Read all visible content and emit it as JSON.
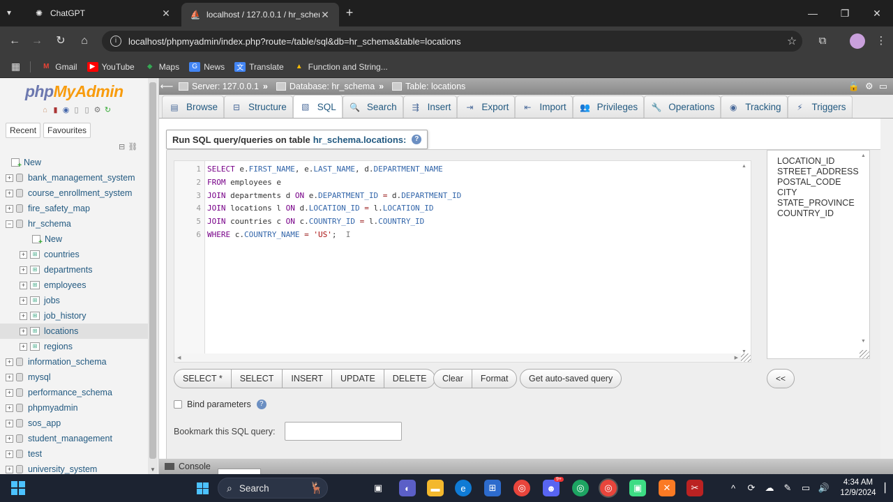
{
  "browser": {
    "tabs": [
      {
        "title": "ChatGPT",
        "icon": "openai-icon",
        "active": false
      },
      {
        "title": "localhost / 127.0.0.1 / hr_schem",
        "icon": "phpmyadmin-sail-icon",
        "active": true
      }
    ],
    "url": "localhost/phpmyadmin/index.php?route=/table/sql&db=hr_schema&table=locations",
    "bookmarks": [
      {
        "label": "Gmail",
        "color": "#ea4335"
      },
      {
        "label": "YouTube",
        "color": "#ff0000"
      },
      {
        "label": "Maps",
        "color": "#34a853"
      },
      {
        "label": "News",
        "color": "#4285f4"
      },
      {
        "label": "Translate",
        "color": "#4285f4"
      },
      {
        "label": "Function and String...",
        "color": "#fbbc04"
      }
    ]
  },
  "sidebar": {
    "logo_php": "php",
    "logo_myadmin": "MyAdmin",
    "tabs": [
      "Recent",
      "Favourites"
    ],
    "new_label": "New",
    "databases": [
      {
        "name": "bank_management_system"
      },
      {
        "name": "course_enrollment_system"
      },
      {
        "name": "fire_safety_map"
      },
      {
        "name": "hr_schema",
        "expanded": true
      }
    ],
    "hr_children": [
      "New",
      "countries",
      "departments",
      "employees",
      "jobs",
      "job_history",
      "locations",
      "regions"
    ],
    "databases_after": [
      "information_schema",
      "mysql",
      "performance_schema",
      "phpmyadmin",
      "sos_app",
      "student_management",
      "test",
      "university_system"
    ]
  },
  "breadcrumb": {
    "server": "Server: 127.0.0.1",
    "database": "Database: hr_schema",
    "table": "Table: locations"
  },
  "menu": {
    "tabs": [
      {
        "label": "Browse",
        "icon": "browse-icon"
      },
      {
        "label": "Structure",
        "icon": "structure-icon"
      },
      {
        "label": "SQL",
        "icon": "sql-icon",
        "active": true
      },
      {
        "label": "Search",
        "icon": "search-icon"
      },
      {
        "label": "Insert",
        "icon": "insert-icon"
      },
      {
        "label": "Export",
        "icon": "export-icon"
      },
      {
        "label": "Import",
        "icon": "import-icon"
      },
      {
        "label": "Privileges",
        "icon": "privileges-icon"
      },
      {
        "label": "Operations",
        "icon": "wrench-icon"
      },
      {
        "label": "Tracking",
        "icon": "eye-icon"
      },
      {
        "label": "Triggers",
        "icon": "triggers-icon"
      }
    ]
  },
  "query": {
    "title_prefix": "Run SQL query/queries on table",
    "title_table": "hr_schema.locations:",
    "lines": [
      "SELECT e.FIRST_NAME, e.LAST_NAME, d.DEPARTMENT_NAME",
      "FROM employees e",
      "JOIN departments d ON e.DEPARTMENT_ID = d.DEPARTMENT_ID",
      "JOIN locations l ON d.LOCATION_ID = l.LOCATION_ID",
      "JOIN countries c ON c.COUNTRY_ID = l.COUNTRY_ID",
      "WHERE c.COUNTRY_NAME = 'US';"
    ],
    "columns": [
      "LOCATION_ID",
      "STREET_ADDRESS",
      "POSTAL_CODE",
      "CITY",
      "STATE_PROVINCE",
      "COUNTRY_ID"
    ],
    "buttons_group1": [
      "SELECT *",
      "SELECT",
      "INSERT",
      "UPDATE",
      "DELETE"
    ],
    "buttons_group2": [
      "Clear",
      "Format"
    ],
    "autosave_label": "Get auto-saved query",
    "insert_col_label": "<<",
    "bind_label": "Bind parameters",
    "bookmark_label": "Bookmark this SQL query:",
    "console_label": "Console"
  },
  "taskbar": {
    "search_label": "Search",
    "time": "4:34 AM",
    "date": "12/9/2024",
    "badge": "9+"
  }
}
